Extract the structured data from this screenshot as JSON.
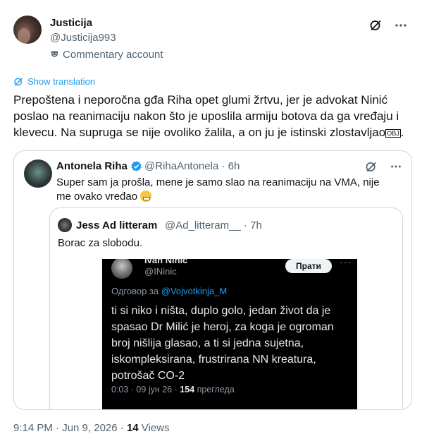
{
  "author": {
    "display_name": "Justicija",
    "handle": "@Justicija993",
    "label": "Commentary account"
  },
  "show_translation": "Show translation",
  "tweet_text": "Prepoštena i neporočna gđa Riha opet glumi žrtvu, jer je advokat Ninić poslao na reanimaciju nakon što je uposlila armiju botova da ga vređaju i klevecu. Na supruga se nije ovoliko žalila, a on ju je istinski zlostavljao",
  "tweet_text_suffix": "OBJ",
  "quoted": {
    "display_name": "Antonela Riha",
    "handle": "@RihaAntonela",
    "separator": "·",
    "time": "6h",
    "text": "Super sam ja prošla, mene je samo slao na reanimaciju na VMA, nije me ovako vređao"
  },
  "nested_quote": {
    "display_name": "Jess Ad litteram",
    "handle": "@Ad_litteram__",
    "separator": "·",
    "time": "7h",
    "text": "Borac za slobodu."
  },
  "screenshot": {
    "name": "Ivan Ninic",
    "handle": "@INinic",
    "follow_label": "Прати",
    "more": "···",
    "reply_prefix": "Одговор за",
    "reply_mention": "@Vojvotkinja_M",
    "body": "ti si niko i ništa, duplo golo, jedan život da je spasao Dr Milić je heroj, za koga je ogroman broj nišlija glasao, a ti si jedna sujetna, iskompleksirana, frustrirana NN kreatura, potrošač CO-2",
    "meta_time": "0:03 · 09 јун 26 ·",
    "views_count": "154",
    "views_label": "прегледа"
  },
  "footer": {
    "timestamp": "9:14 PM · Jun 9, 2026 ·",
    "views_count": "14",
    "views_label": "Views"
  },
  "colors": {
    "accent": "#1d9bf0",
    "muted": "#536471",
    "border": "#cfd9de"
  }
}
